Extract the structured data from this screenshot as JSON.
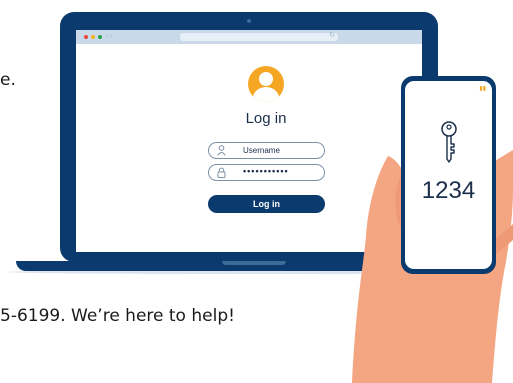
{
  "background_text": {
    "top_fragment": "e.",
    "bottom_fragment": "5-6199. We’re here to help!"
  },
  "browser": {
    "nav_arrows": "‹ ›"
  },
  "login": {
    "title": "Log in",
    "username_placeholder": "Username",
    "password_value": "•••••••••••",
    "button_label": "Log in"
  },
  "phone": {
    "pin": "1234"
  },
  "icons": {
    "avatar": "user-icon",
    "username": "user-outline-icon",
    "password": "lock-icon",
    "phone": "key-icon"
  },
  "colors": {
    "navy": "#0b3a6e",
    "accent_orange": "#f5a623",
    "skin": "#f4a582",
    "browser_bar": "#c9d9ea"
  }
}
